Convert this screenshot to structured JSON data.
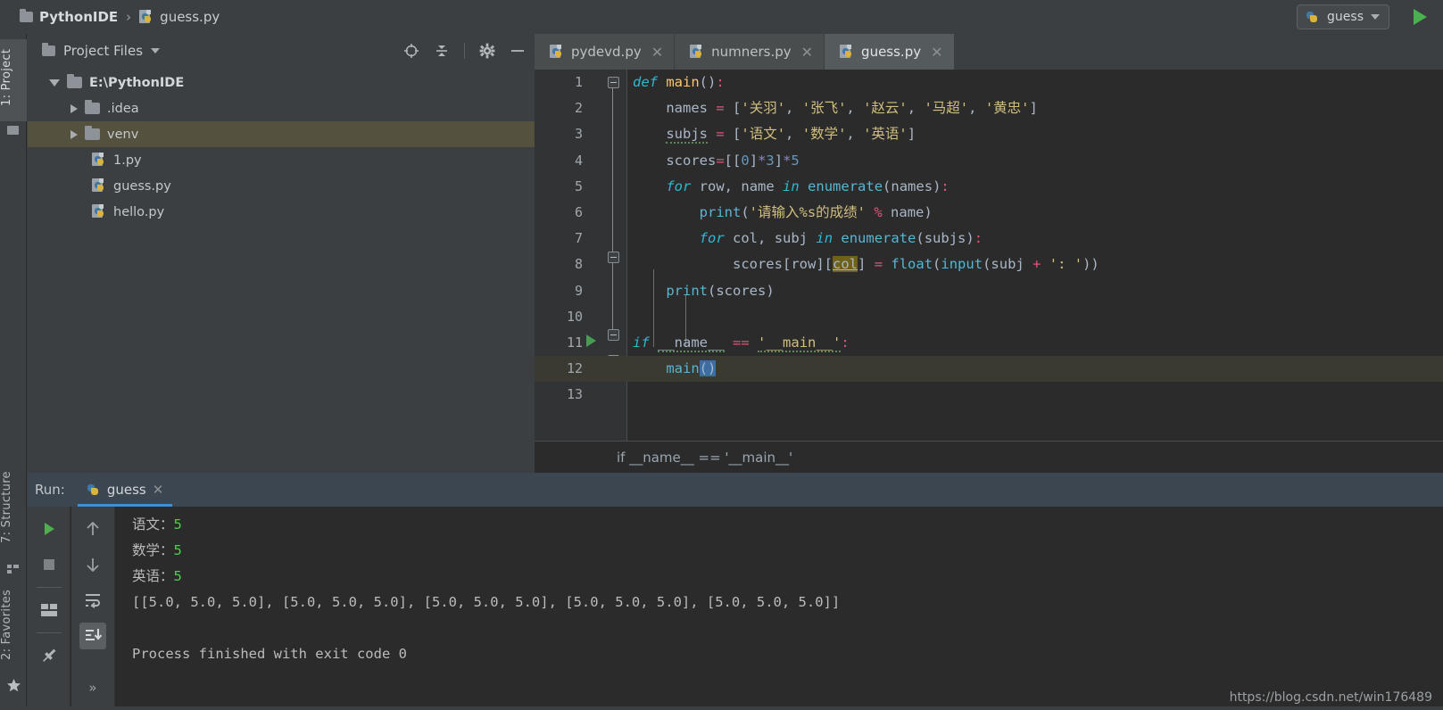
{
  "window": {
    "breadcrumb": {
      "project": "PythonIDE",
      "separator": "›",
      "file": "guess.py",
      "folder_icon": "folder-icon",
      "file_icon": "python-file-icon"
    },
    "run_config": {
      "name": "guess",
      "icon": "python-config-icon",
      "caret": "chevron-down-icon"
    },
    "run_button_icon": "run-play-icon"
  },
  "left_strip": {
    "tabs": [
      {
        "label": "1: Project",
        "active": true,
        "icon": "project-icon"
      },
      {
        "label": "7: Structure",
        "active": false,
        "icon": "structure-icon"
      },
      {
        "label": "2: Favorites",
        "active": false,
        "icon": "star-icon"
      }
    ]
  },
  "project_panel": {
    "title": "Project Files",
    "title_caret": "chevron-down-icon",
    "toolbar_icons": [
      "locate-target-icon",
      "collapse-all-icon",
      "gear-icon",
      "minimize-icon"
    ],
    "tree": [
      {
        "label": "E:\\PythonIDE",
        "type": "folder",
        "state": "expanded",
        "depth": 0,
        "selected": false
      },
      {
        "label": ".idea",
        "type": "folder",
        "state": "collapsed",
        "depth": 1,
        "selected": false
      },
      {
        "label": "venv",
        "type": "folder",
        "state": "collapsed",
        "depth": 1,
        "selected": true
      },
      {
        "label": "1.py",
        "type": "python-file",
        "state": "leaf",
        "depth": 2,
        "selected": false
      },
      {
        "label": "guess.py",
        "type": "python-file",
        "state": "leaf",
        "depth": 2,
        "selected": false
      },
      {
        "label": "hello.py",
        "type": "python-file",
        "state": "leaf",
        "depth": 2,
        "selected": false
      }
    ]
  },
  "editor": {
    "tabs": [
      {
        "label": "pydevd.py",
        "active": false,
        "close_icon": "close-icon"
      },
      {
        "label": "numners.py",
        "active": false,
        "close_icon": "close-icon"
      },
      {
        "label": "guess.py",
        "active": true,
        "close_icon": "close-icon"
      }
    ],
    "line_numbers": [
      "1",
      "2",
      "3",
      "4",
      "5",
      "6",
      "7",
      "8",
      "9",
      "10",
      "11",
      "12",
      "13"
    ],
    "current_line": 12,
    "gutter_run_line": 11,
    "code_lines": [
      "def main():",
      "    names = ['关羽', '张飞', '赵云', '马超', '黄忠']",
      "    subjs = ['语文', '数学', '英语']",
      "    scores=[[0]*3]*5",
      "    for row, name in enumerate(names):",
      "        print('请输入%s的成绩' % name)",
      "        for col, subj in enumerate(subjs):",
      "            scores[row][col] = float(input(subj + ': '))",
      "    print(scores)",
      "",
      "if __name__ == '__main__':",
      "    main()",
      ""
    ],
    "breadcrumb_bottom": [
      "if __name__ == '__main__'"
    ]
  },
  "run_panel": {
    "label": "Run:",
    "tab": {
      "label": "guess",
      "icon": "python-config-icon",
      "close_icon": "close-icon"
    },
    "toolbar_left": [
      "rerun-play-icon",
      "stop-icon",
      "restore-layout-icon",
      "pin-tab-icon"
    ],
    "toolbar_right": [
      "up-arrow-icon",
      "down-arrow-icon",
      "soft-wrap-icon",
      "scroll-to-end-icon",
      "expand-more-icon"
    ],
    "console": [
      {
        "prompt": "语文：",
        "input": "5"
      },
      {
        "prompt": "数学：",
        "input": "5"
      },
      {
        "prompt": "英语：",
        "input": "5"
      },
      {
        "prompt": "[[5.0, 5.0, 5.0], [5.0, 5.0, 5.0], [5.0, 5.0, 5.0], [5.0, 5.0, 5.0], [5.0, 5.0, 5.0]]",
        "input": ""
      },
      {
        "prompt": "",
        "input": ""
      },
      {
        "prompt": "Process finished with exit code 0",
        "input": ""
      }
    ]
  },
  "watermark": "https://blog.csdn.net/win176489",
  "colors": {
    "accent_blue": "#3f8fd6",
    "run_green": "#499c54",
    "selection_blue": "#3a6ea5",
    "tree_selection": "#54513f",
    "editor_bg": "#2b2b2b",
    "panel_bg": "#3c3f41"
  }
}
